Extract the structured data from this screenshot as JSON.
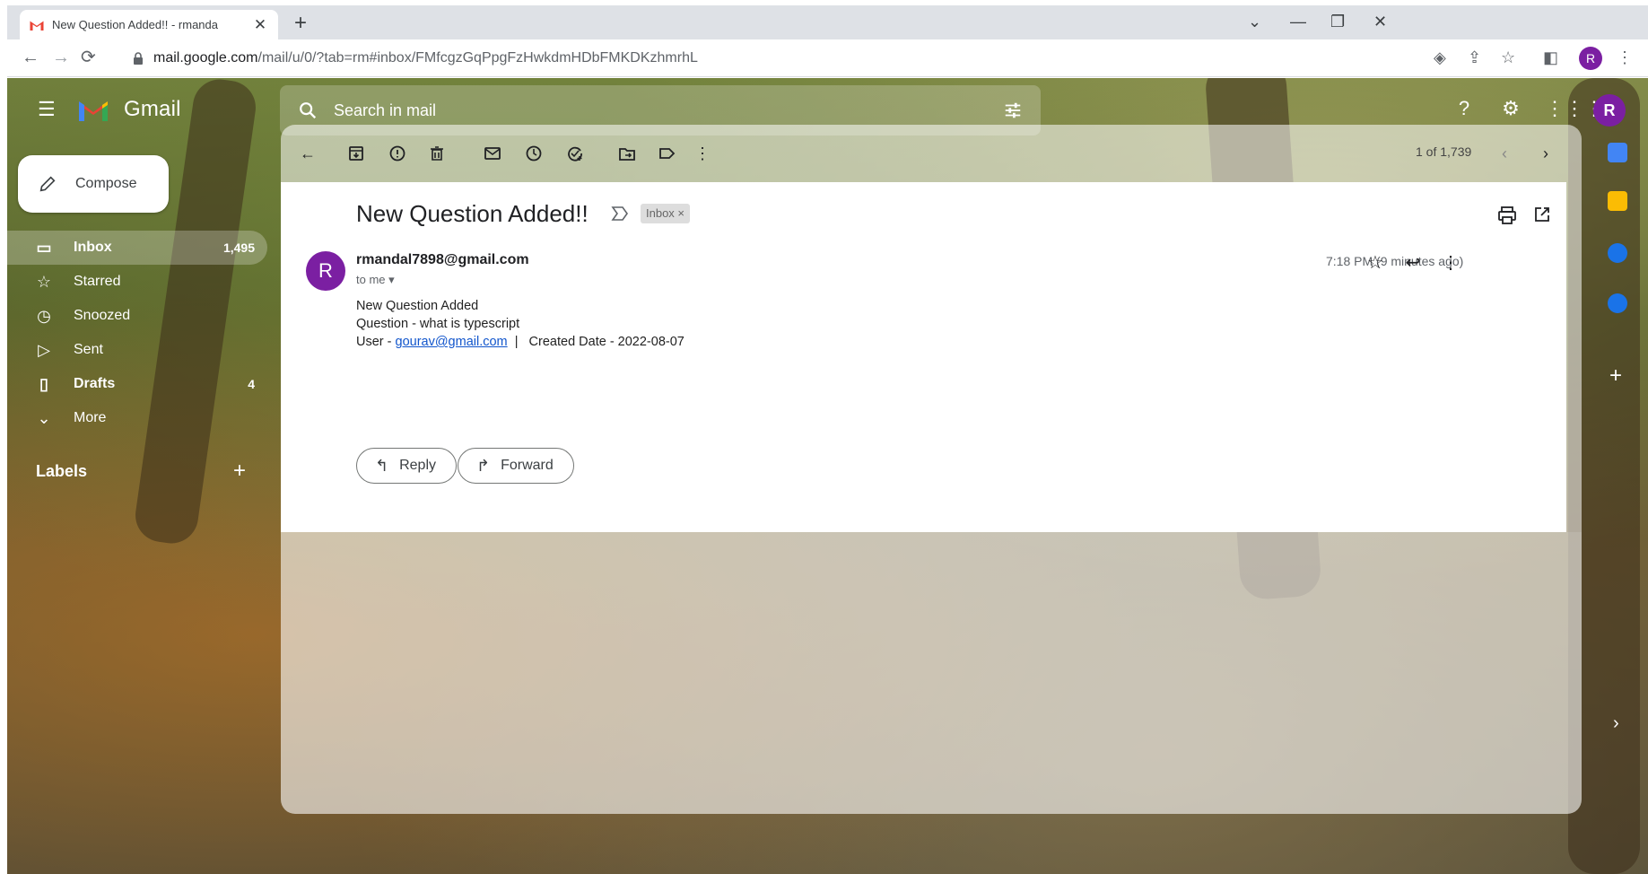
{
  "browser": {
    "tab_title": "New Question Added!! - rmanda",
    "tab_close": "✕",
    "new_tab": "+",
    "url_host": "mail.google.com",
    "url_path": "/mail/u/0/?tab=rm#inbox/FMfcgzGqPpgFzHwkdmHDbFMKDKzhmrhL",
    "profile_initial": "R"
  },
  "header": {
    "app_name": "Gmail",
    "search_placeholder": "Search in mail",
    "avatar_initial": "R"
  },
  "sidebar": {
    "compose_label": "Compose",
    "items": [
      {
        "label": "Inbox",
        "count": "1,495",
        "icon": "inbox-icon",
        "active": true
      },
      {
        "label": "Starred",
        "count": "",
        "icon": "star-icon",
        "active": false
      },
      {
        "label": "Snoozed",
        "count": "",
        "icon": "clock-icon",
        "active": false
      },
      {
        "label": "Sent",
        "count": "",
        "icon": "send-icon",
        "active": false
      },
      {
        "label": "Drafts",
        "count": "4",
        "icon": "draft-icon",
        "active": false
      },
      {
        "label": "More",
        "count": "",
        "icon": "chevron-down-icon",
        "active": false
      }
    ],
    "labels_title": "Labels"
  },
  "toolbar": {
    "pager": "1 of 1,739"
  },
  "message": {
    "subject": "New Question Added!!",
    "label_chip": "Inbox ×",
    "sender": "rmandal7898@gmail.com",
    "sender_initial": "R",
    "recipient": "to me",
    "time": "7:18 PM (9 minutes ago)",
    "body_line1": "New Question Added",
    "body_line2": "Question - what is typescript",
    "body_line3_prefix": "User - ",
    "body_link": "gourav@gmail.com",
    "body_line3_suffix": "  |   Created Date - 2022-08-07",
    "reply_label": "Reply",
    "forward_label": "Forward"
  },
  "colors": {
    "avatar": "#7b1fa2",
    "link": "#1155cc"
  }
}
